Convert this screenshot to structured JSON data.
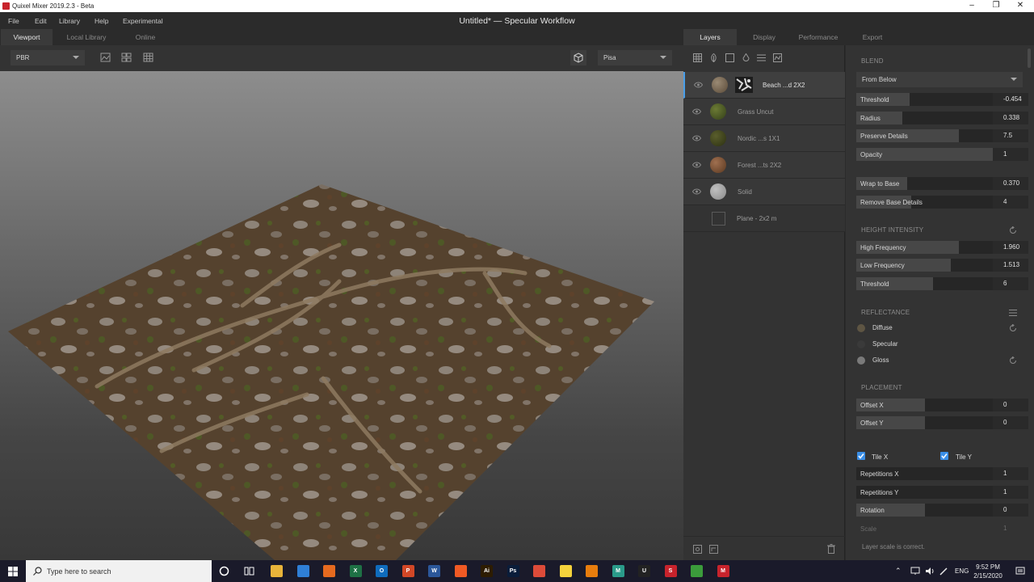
{
  "titlebar": {
    "app_title": "Quixel Mixer 2019.2.3 - Beta",
    "minimize": "–",
    "maximize": "❐",
    "close": "✕"
  },
  "menu": {
    "items": [
      "File",
      "Edit",
      "Library",
      "Help",
      "Experimental"
    ]
  },
  "document_title": "Untitled* — Specular Workflow",
  "left_tabs": [
    "Viewport",
    "Local Library",
    "Online"
  ],
  "viewport_toolbar": {
    "render_mode": "PBR",
    "environment": "Pisa"
  },
  "right_tabs": [
    "Layers",
    "Display",
    "Performance",
    "Export"
  ],
  "layers": [
    {
      "name": "Beach ...d 2X2",
      "selected": true,
      "thumb_color": "#7a6a58",
      "has_mask": true
    },
    {
      "name": "Grass Uncut",
      "selected": false,
      "thumb_color": "#4c5a26",
      "has_mask": false
    },
    {
      "name": "Nordic ...s 1X1",
      "selected": false,
      "thumb_color": "#3f4420",
      "has_mask": false
    },
    {
      "name": "Forest ...ts 2X2",
      "selected": false,
      "thumb_color": "#7a5538",
      "has_mask": false
    },
    {
      "name": "Solid",
      "selected": false,
      "thumb_color": "#9a9a9a",
      "has_mask": false
    }
  ],
  "mesh_label": "Plane - 2x2 m",
  "blend": {
    "title": "BLEND",
    "mode": "From Below",
    "sliders": [
      {
        "label": "Threshold",
        "value": "-0.454",
        "fill": 0.39
      },
      {
        "label": "Radius",
        "value": "0.338",
        "fill": 0.34
      },
      {
        "label": "Preserve Details",
        "value": "7.5",
        "fill": 0.75
      },
      {
        "label": "Opacity",
        "value": "1",
        "fill": 1.0
      }
    ],
    "base_sliders": [
      {
        "label": "Wrap to Base",
        "value": "0.370",
        "fill": 0.37
      },
      {
        "label": "Remove Base Details",
        "value": "4",
        "fill": 0.4
      }
    ]
  },
  "height_intensity": {
    "title": "HEIGHT INTENSITY",
    "sliders": [
      {
        "label": "High Frequency",
        "value": "1.960",
        "fill": 0.75
      },
      {
        "label": "Low Frequency",
        "value": "1.513",
        "fill": 0.69
      },
      {
        "label": "Threshold",
        "value": "6",
        "fill": 0.56
      }
    ]
  },
  "reflectance": {
    "title": "REFLECTANCE",
    "items": [
      {
        "label": "Diffuse",
        "color": "#5e5543"
      },
      {
        "label": "Specular",
        "color": "#3a3a3a"
      },
      {
        "label": "Gloss",
        "color": "#7a7a7a"
      }
    ]
  },
  "placement": {
    "title": "PLACEMENT",
    "sliders": [
      {
        "label": "Offset X",
        "value": "0",
        "fill": 0.5
      },
      {
        "label": "Offset Y",
        "value": "0",
        "fill": 0.5
      }
    ],
    "tile_x": "Tile X",
    "tile_y": "Tile Y",
    "tile_sliders": [
      {
        "label": "Repetitions X",
        "value": "1",
        "fill": 0.0
      },
      {
        "label": "Repetitions Y",
        "value": "1",
        "fill": 0.0
      },
      {
        "label": "Rotation",
        "value": "0",
        "fill": 0.5
      }
    ],
    "scale_label": "Scale",
    "scale_value": "1"
  },
  "status_message": "Layer scale is correct.",
  "taskbar": {
    "search_placeholder": "Type here to search",
    "lang": "ENG",
    "time": "9:52 PM",
    "date": "2/15/2020",
    "apps": [
      {
        "name": "file-explorer",
        "color": "#e8b43a",
        "glyph": ""
      },
      {
        "name": "store",
        "color": "#2f7fd6",
        "glyph": ""
      },
      {
        "name": "firefox",
        "color": "#e66a1f",
        "glyph": ""
      },
      {
        "name": "excel",
        "color": "#1e7145",
        "glyph": "X"
      },
      {
        "name": "outlook",
        "color": "#0f6cbd",
        "glyph": "O"
      },
      {
        "name": "powerpoint",
        "color": "#d24726",
        "glyph": "P"
      },
      {
        "name": "word",
        "color": "#2b579a",
        "glyph": "W"
      },
      {
        "name": "brave",
        "color": "#f15a24",
        "glyph": ""
      },
      {
        "name": "illustrator",
        "color": "#2d1c00",
        "glyph": "Ai"
      },
      {
        "name": "photoshop",
        "color": "#0a1d3a",
        "glyph": "Ps"
      },
      {
        "name": "chrome",
        "color": "#dd4b39",
        "glyph": ""
      },
      {
        "name": "sticky-notes",
        "color": "#f4d23c",
        "glyph": ""
      },
      {
        "name": "blender",
        "color": "#e87d0d",
        "glyph": ""
      },
      {
        "name": "mixer-m",
        "color": "#2a9b8a",
        "glyph": "M"
      },
      {
        "name": "unreal",
        "color": "#222222",
        "glyph": "U"
      },
      {
        "name": "substance",
        "color": "#c8232c",
        "glyph": "S"
      },
      {
        "name": "green-app",
        "color": "#3b9c3b",
        "glyph": ""
      },
      {
        "name": "quixel-mixer",
        "color": "#c8232c",
        "glyph": "M"
      }
    ]
  }
}
